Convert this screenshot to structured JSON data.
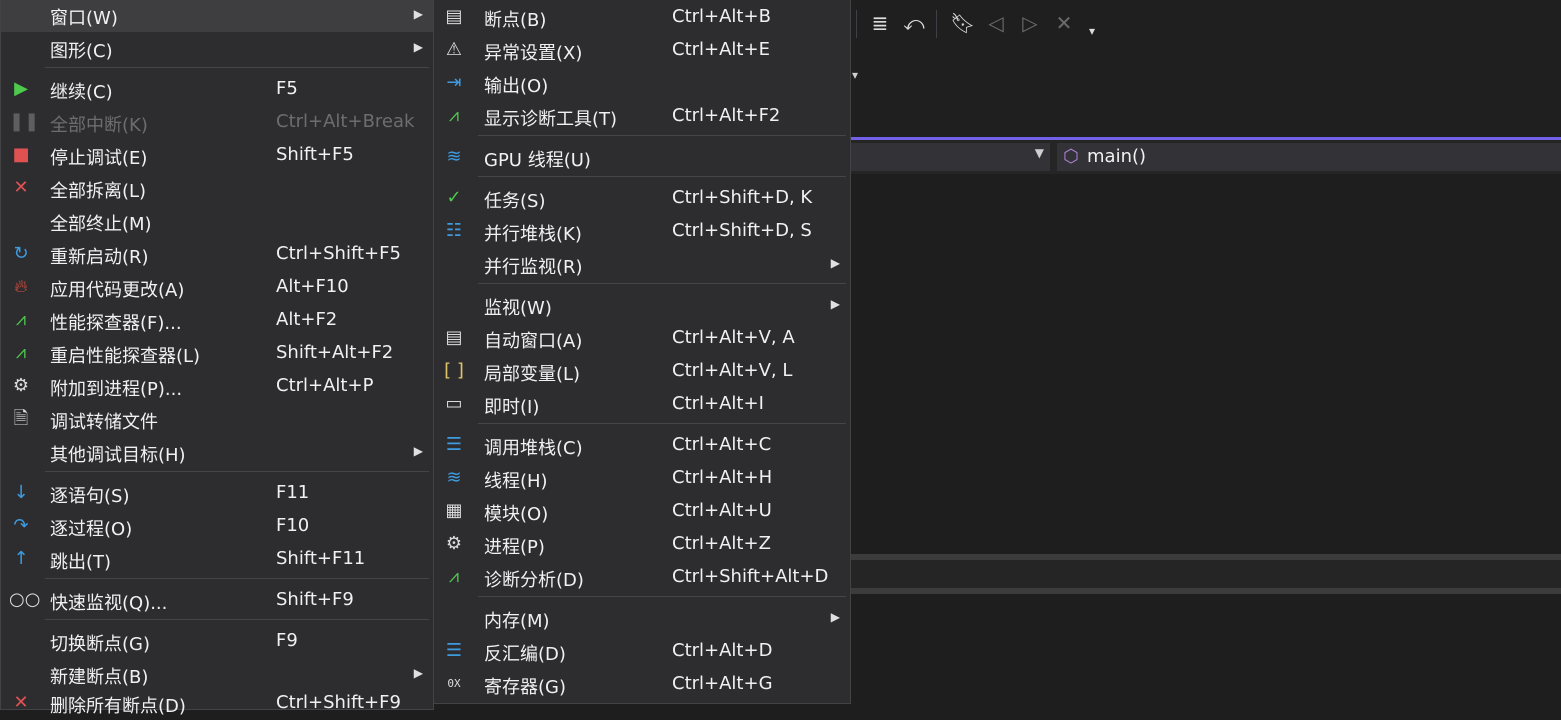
{
  "colors": {
    "menu_bg": "#2d2d30",
    "accent_purple": "#7160e8",
    "play_green": "#4ec94e",
    "stop_red": "#e05252",
    "icon_blue": "#3d9be0"
  },
  "navbar": {
    "function_name": "main()"
  },
  "debug_menu": {
    "items": [
      {
        "label": "窗口(W)",
        "shortcut": "",
        "icon": "",
        "submenu": true
      },
      {
        "label": "图形(C)",
        "shortcut": "",
        "icon": "",
        "submenu": true
      },
      {
        "label": "继续(C)",
        "shortcut": "F5",
        "icon": "play-icon"
      },
      {
        "label": "全部中断(K)",
        "shortcut": "Ctrl+Alt+Break",
        "icon": "pause-icon",
        "disabled": true
      },
      {
        "label": "停止调试(E)",
        "shortcut": "Shift+F5",
        "icon": "stop-icon"
      },
      {
        "label": "全部拆离(L)",
        "shortcut": "",
        "icon": "detach-icon"
      },
      {
        "label": "全部终止(M)",
        "shortcut": "",
        "icon": ""
      },
      {
        "label": "重新启动(R)",
        "shortcut": "Ctrl+Shift+F5",
        "icon": "restart-icon"
      },
      {
        "label": "应用代码更改(A)",
        "shortcut": "Alt+F10",
        "icon": "hot-reload-icon"
      },
      {
        "label": "性能探查器(F)...",
        "shortcut": "Alt+F2",
        "icon": "profiler-icon"
      },
      {
        "label": "重启性能探查器(L)",
        "shortcut": "Shift+Alt+F2",
        "icon": "relaunch-profiler-icon"
      },
      {
        "label": "附加到进程(P)...",
        "shortcut": "Ctrl+Alt+P",
        "icon": "attach-process-icon"
      },
      {
        "label": "调试转储文件",
        "shortcut": "",
        "icon": "dump-file-icon"
      },
      {
        "label": "其他调试目标(H)",
        "shortcut": "",
        "icon": "",
        "submenu": true
      },
      {
        "label": "逐语句(S)",
        "shortcut": "F11",
        "icon": "step-into-icon"
      },
      {
        "label": "逐过程(O)",
        "shortcut": "F10",
        "icon": "step-over-icon"
      },
      {
        "label": "跳出(T)",
        "shortcut": "Shift+F11",
        "icon": "step-out-icon"
      },
      {
        "label": "快速监视(Q)...",
        "shortcut": "Shift+F9",
        "icon": "glasses-icon"
      },
      {
        "label": "切换断点(G)",
        "shortcut": "F9",
        "icon": ""
      },
      {
        "label": "新建断点(B)",
        "shortcut": "",
        "icon": "",
        "submenu": true
      },
      {
        "label": "删除所有断点(D)",
        "shortcut": "Ctrl+Shift+F9",
        "icon": "delete-breakpoints-icon"
      }
    ]
  },
  "window_menu": {
    "items": [
      {
        "label": "断点(B)",
        "shortcut": "Ctrl+Alt+B",
        "icon": "breakpoints-window-icon"
      },
      {
        "label": "异常设置(X)",
        "shortcut": "Ctrl+Alt+E",
        "icon": "exception-settings-icon"
      },
      {
        "label": "输出(O)",
        "shortcut": "",
        "icon": "output-icon"
      },
      {
        "label": "显示诊断工具(T)",
        "shortcut": "Ctrl+Alt+F2",
        "icon": "diagnostic-tools-icon"
      },
      {
        "label": "GPU 线程(U)",
        "shortcut": "",
        "icon": "gpu-threads-icon"
      },
      {
        "label": "任务(S)",
        "shortcut": "Ctrl+Shift+D, K",
        "icon": "tasks-icon"
      },
      {
        "label": "并行堆栈(K)",
        "shortcut": "Ctrl+Shift+D, S",
        "icon": "parallel-stacks-icon"
      },
      {
        "label": "并行监视(R)",
        "shortcut": "",
        "icon": "",
        "submenu": true
      },
      {
        "label": "监视(W)",
        "shortcut": "",
        "icon": "",
        "submenu": true
      },
      {
        "label": "自动窗口(A)",
        "shortcut": "Ctrl+Alt+V, A",
        "icon": "autos-icon"
      },
      {
        "label": "局部变量(L)",
        "shortcut": "Ctrl+Alt+V, L",
        "icon": "locals-icon"
      },
      {
        "label": "即时(I)",
        "shortcut": "Ctrl+Alt+I",
        "icon": "immediate-icon"
      },
      {
        "label": "调用堆栈(C)",
        "shortcut": "Ctrl+Alt+C",
        "icon": "call-stack-icon"
      },
      {
        "label": "线程(H)",
        "shortcut": "Ctrl+Alt+H",
        "icon": "threads-icon"
      },
      {
        "label": "模块(O)",
        "shortcut": "Ctrl+Alt+U",
        "icon": "modules-icon"
      },
      {
        "label": "进程(P)",
        "shortcut": "Ctrl+Alt+Z",
        "icon": "processes-icon"
      },
      {
        "label": "诊断分析(D)",
        "shortcut": "Ctrl+Shift+Alt+D",
        "icon": "diagnostics-analysis-icon"
      },
      {
        "label": "内存(M)",
        "shortcut": "",
        "icon": "",
        "submenu": true
      },
      {
        "label": "反汇编(D)",
        "shortcut": "Ctrl+Alt+D",
        "icon": "disassembly-icon"
      },
      {
        "label": "寄存器(G)",
        "shortcut": "Ctrl+Alt+G",
        "icon": "registers-icon"
      }
    ]
  }
}
